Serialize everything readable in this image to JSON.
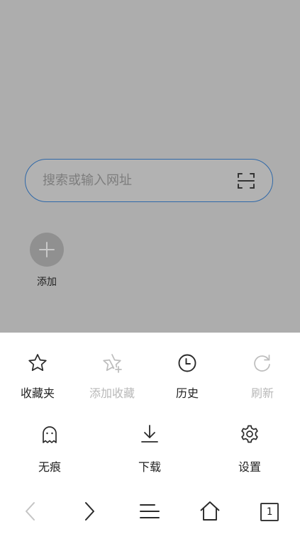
{
  "search": {
    "placeholder": "搜索或输入网址",
    "scan_icon": "scan-icon"
  },
  "shortcut": {
    "add_label": "添加"
  },
  "menu": {
    "row1": [
      {
        "label": "收藏夹",
        "icon": "star-icon",
        "enabled": true
      },
      {
        "label": "添加收藏",
        "icon": "star-plus-icon",
        "enabled": false
      },
      {
        "label": "历史",
        "icon": "clock-icon",
        "enabled": true
      },
      {
        "label": "刷新",
        "icon": "refresh-icon",
        "enabled": false
      }
    ],
    "row2": [
      {
        "label": "无痕",
        "icon": "ghost-icon",
        "enabled": true
      },
      {
        "label": "下载",
        "icon": "download-icon",
        "enabled": true
      },
      {
        "label": "设置",
        "icon": "gear-icon",
        "enabled": true
      }
    ]
  },
  "nav": {
    "tab_count": "1"
  },
  "colors": {
    "overlay": "#adadad",
    "search_border": "#2f68a8",
    "disabled_text": "#b8b8b8"
  }
}
